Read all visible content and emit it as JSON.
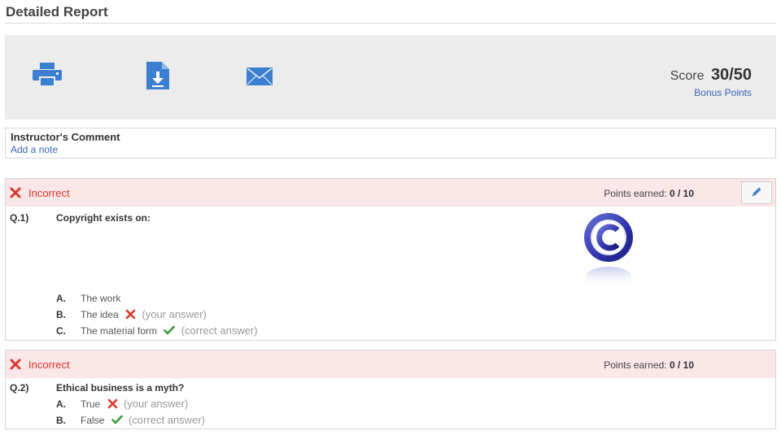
{
  "page": {
    "title": "Detailed Report"
  },
  "toolbar": {
    "print_icon": "printer-icon",
    "download_icon": "download-file-icon",
    "email_icon": "envelope-icon",
    "score_label": "Score",
    "score_value": "30/50",
    "bonus_link": "Bonus Points"
  },
  "comment": {
    "title": "Instructor's Comment",
    "add_note": "Add a note"
  },
  "questions": [
    {
      "status": "Incorrect",
      "points_label": "Points earned:",
      "points_value": "0 / 10",
      "number": "Q.1)",
      "text": "Copyright exists on:",
      "image": "copyright-symbol-image",
      "options": [
        {
          "letter": "A.",
          "text": "The work",
          "note": ""
        },
        {
          "letter": "B.",
          "text": "The idea",
          "mark": "wrong",
          "note": "(your answer)"
        },
        {
          "letter": "C.",
          "text": "The material form",
          "mark": "correct",
          "note": "(correct answer)"
        }
      ]
    },
    {
      "status": "Incorrect",
      "points_label": "Points earned:",
      "points_value": "0 / 10",
      "number": "Q.2)",
      "text": "Ethical business is a myth?",
      "options": [
        {
          "letter": "A.",
          "text": "True",
          "mark": "wrong",
          "note": "(your answer)"
        },
        {
          "letter": "B.",
          "text": "False",
          "mark": "correct",
          "note": "(correct answer)"
        }
      ]
    }
  ],
  "colors": {
    "accent_blue": "#3b7fd1",
    "incorrect_red": "#d9372b",
    "correct_green": "#3a9a3a",
    "header_pink": "#fbe6e8"
  }
}
